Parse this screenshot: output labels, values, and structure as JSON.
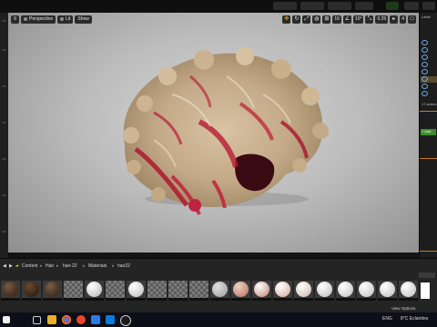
{
  "viewport": {
    "perspective_label": "Perspective",
    "lit_label": "Lit",
    "show_label": "Show",
    "grid_snap": "10",
    "rotation_snap": "10°",
    "scale_snap": "0.25",
    "camera_speed": "4"
  },
  "right_panel": {
    "tab_label": "Label",
    "count_text": "17 actors",
    "add_label": "+ Add"
  },
  "breadcrumb": {
    "items": [
      "Content",
      "Hair",
      "hair-22",
      "Materials",
      "hair22"
    ]
  },
  "content_browser": {
    "view_options_label": "View Options"
  },
  "taskbar": {
    "lang": "ENG",
    "status_text": "8°C  Eclairdes"
  },
  "colors": {
    "accent_orange": "#f0a000",
    "hair_red": "#c0203a",
    "hair_blond": "#c9b392"
  }
}
